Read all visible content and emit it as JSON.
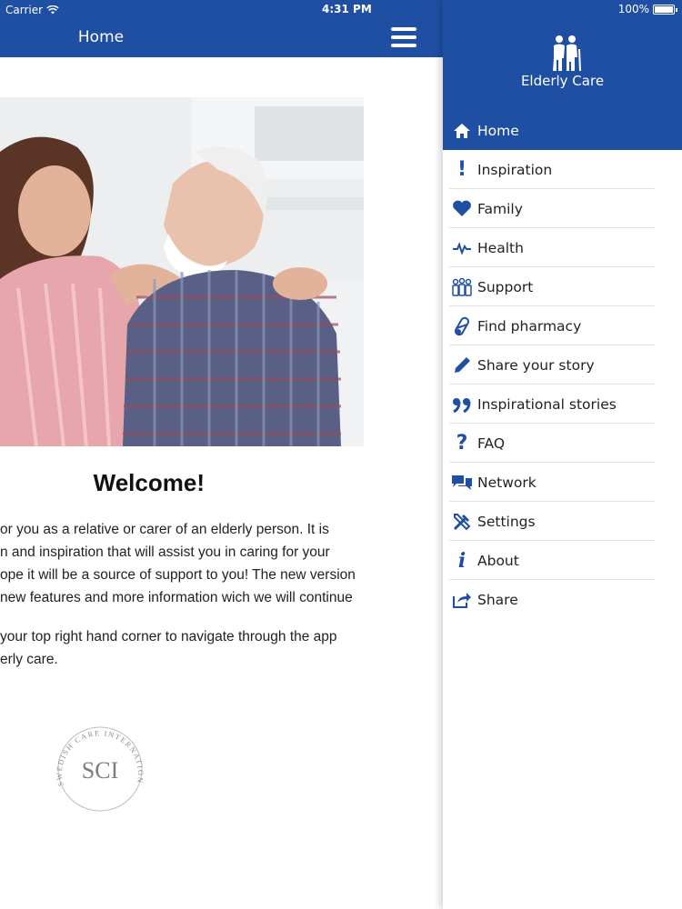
{
  "status_bar": {
    "carrier": "Carrier",
    "time": "4:31 PM",
    "battery": "100%"
  },
  "main": {
    "title": "Home",
    "welcome": "Welcome!",
    "paragraph1_lines": [
      "or you as a relative or carer of an elderly person. It is",
      "n and inspiration that will assist you in caring for your",
      "ope it will be a source of support to you! The new version",
      "new features and more information wich we will continue"
    ],
    "paragraph2_lines": [
      "your top right hand corner to navigate through the app",
      "erly care."
    ],
    "logo": {
      "initials": "SCI",
      "ring_text": "SWEDISH CARE INTERNATIONAL"
    }
  },
  "drawer": {
    "app_name": "Elderly Care",
    "items": [
      {
        "label": "Home",
        "icon": "home-icon",
        "active": true
      },
      {
        "label": "Inspiration",
        "icon": "exclamation-icon"
      },
      {
        "label": "Family",
        "icon": "heart-icon"
      },
      {
        "label": "Health",
        "icon": "pulse-icon"
      },
      {
        "label": "Support",
        "icon": "people-icon"
      },
      {
        "label": "Find pharmacy",
        "icon": "pill-icon"
      },
      {
        "label": "Share your story",
        "icon": "pencil-icon"
      },
      {
        "label": "Inspirational stories",
        "icon": "quote-icon"
      },
      {
        "label": "FAQ",
        "icon": "question-icon"
      },
      {
        "label": "Network",
        "icon": "chat-icon"
      },
      {
        "label": "Settings",
        "icon": "tools-icon"
      },
      {
        "label": "About",
        "icon": "info-icon"
      },
      {
        "label": "Share",
        "icon": "share-icon"
      }
    ]
  },
  "colors": {
    "brand_blue": "#1f4fa3"
  }
}
